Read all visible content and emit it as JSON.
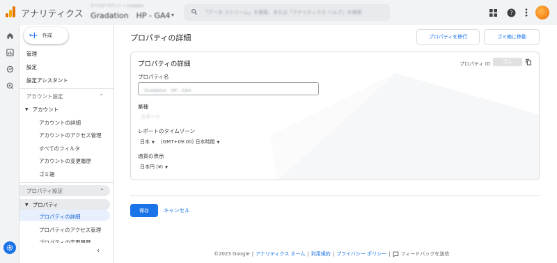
{
  "app": {
    "title": "アナリティクス",
    "account_sub": "すべてのアカウント > Gradation",
    "account_main": "Gradation　HP - GA4",
    "account_caret": "▾"
  },
  "search": {
    "placeholder": "「データ ストリーム」を検索、または「アナリティクス ヘルプ」を検索"
  },
  "nav": {
    "create_label": "作成",
    "items": {
      "admin": "管理",
      "settings": "設定",
      "setup_assistant": "設定アシスタント"
    },
    "account_section": "アカウント設定",
    "account_group": "アカウント",
    "account_items": [
      "アカウントの詳細",
      "アカウントのアクセス管理",
      "すべてのフィルタ",
      "アカウントの変更履歴",
      "ゴミ箱"
    ],
    "property_section": "プロパティ設定",
    "property_group": "プロパティ",
    "property_items": [
      "プロパティの詳細",
      "プロパティのアクセス管理",
      "プロパティの変更履歴"
    ]
  },
  "main": {
    "page_title": "プロパティの詳細",
    "move_button": "プロパティを移行",
    "trash_button": "ゴミ箱に移動",
    "card_title": "プロパティの詳細",
    "property_id_label": "プロパティ ID",
    "property_id_value": "コレ",
    "property_name_label": "プロパティ名",
    "property_name_value": "Gradation　HP - GA4",
    "industry_label": "業種",
    "industry_value": "スポーツ",
    "timezone_label": "レポートのタイムゾーン",
    "timezone_country": "日本",
    "timezone_value": "(GMT+09:00) 日本時間",
    "currency_label": "通貨の表示",
    "currency_value": "日本円 (¥)",
    "save_button": "保存",
    "cancel_button": "キャンセル"
  },
  "footer": {
    "copyright": "©2023 Google",
    "sep": "|",
    "home_link": "アナリティクス ホーム",
    "terms_link": "利用規約",
    "privacy_link": "プライバシー ポリシー",
    "feedback": "フィードバックを送信"
  },
  "colors": {
    "accent": "#1a73e8",
    "brand_orange": "#e37400",
    "brand_yellow": "#f9ab00"
  }
}
